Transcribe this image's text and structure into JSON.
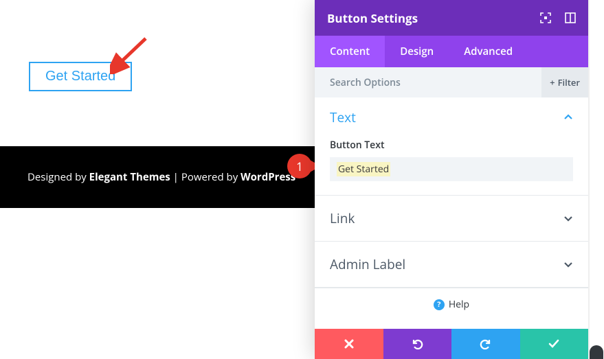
{
  "preview": {
    "button_label": "Get Started"
  },
  "footer": {
    "prefix": "Designed by ",
    "brand": "Elegant Themes",
    "mid": " | Powered by ",
    "cms": "WordPress"
  },
  "callout": {
    "number": "1"
  },
  "panel": {
    "title": "Button Settings",
    "tabs": {
      "content": "Content",
      "design": "Design",
      "advanced": "Advanced"
    },
    "search_placeholder": "Search Options",
    "filter_label": "Filter",
    "sections": {
      "text": {
        "title": "Text",
        "field_label": "Button Text",
        "field_value": "Get Started"
      },
      "link": {
        "title": "Link"
      },
      "admin": {
        "title": "Admin Label"
      }
    },
    "help_label": "Help"
  }
}
